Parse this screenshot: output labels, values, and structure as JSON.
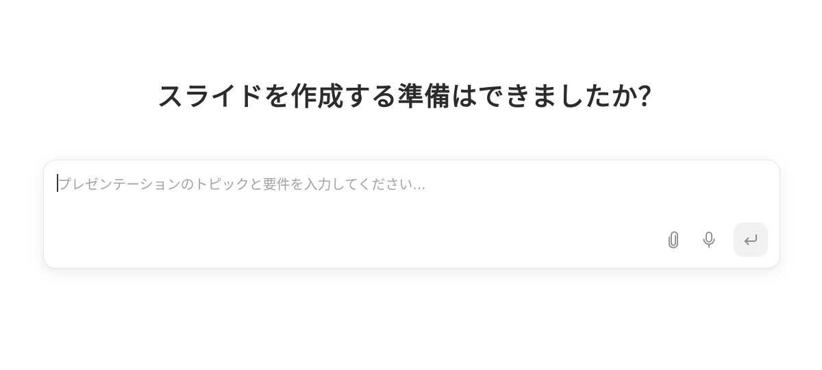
{
  "page": {
    "heading": "スライドを作成する準備はできましたか？"
  },
  "composer": {
    "placeholder": "プレゼンテーションのトピックと要件を入力してください...",
    "value": "",
    "icons": {
      "attach": "paperclip-icon",
      "mic": "microphone-icon",
      "submit": "enter-return-icon"
    },
    "colors": {
      "icon": "#8a8a8a",
      "submit_bg": "#f1f1f1",
      "placeholder": "#a3a3a3",
      "heading": "#2b2b2b"
    }
  }
}
